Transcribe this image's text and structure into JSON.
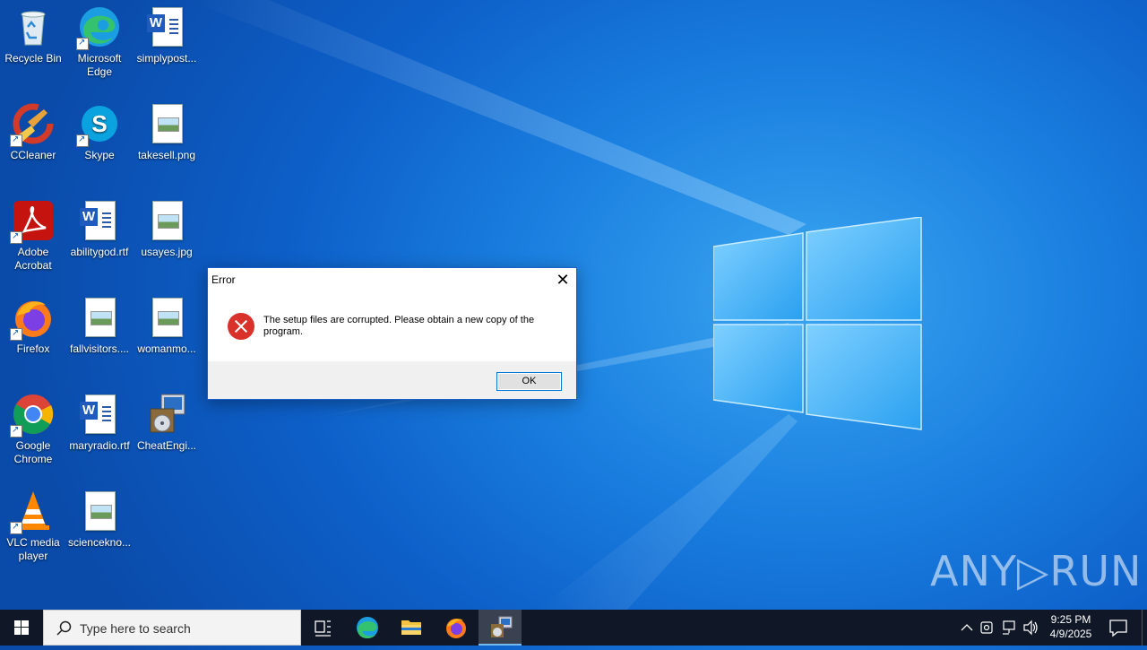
{
  "desktop": {
    "icons": [
      {
        "label": "Recycle Bin"
      },
      {
        "label": "Microsoft Edge"
      },
      {
        "label": "simplypost..."
      },
      {
        "label": "CCleaner"
      },
      {
        "label": "Skype"
      },
      {
        "label": "takesell.png"
      },
      {
        "label": "Adobe Acrobat"
      },
      {
        "label": "abilitygod.rtf"
      },
      {
        "label": "usayes.jpg"
      },
      {
        "label": "Firefox"
      },
      {
        "label": "fallvisitors...."
      },
      {
        "label": "womanmo..."
      },
      {
        "label": "Google Chrome"
      },
      {
        "label": "maryradio.rtf"
      },
      {
        "label": "CheatEngi..."
      },
      {
        "label": "VLC media player"
      },
      {
        "label": "sciencekno..."
      }
    ]
  },
  "dialog": {
    "title": "Error",
    "message": "The setup files are corrupted. Please obtain a new copy of the program.",
    "ok_label": "OK",
    "close_symbol": "✕"
  },
  "watermark": {
    "text": "ANY▷RUN"
  },
  "taskbar": {
    "search_placeholder": "Type here to search",
    "time": "9:25 PM",
    "date": "4/9/2025"
  },
  "colors": {
    "accent": "#0078d7",
    "taskbar": "#101827",
    "error_red": "#d9322a"
  }
}
